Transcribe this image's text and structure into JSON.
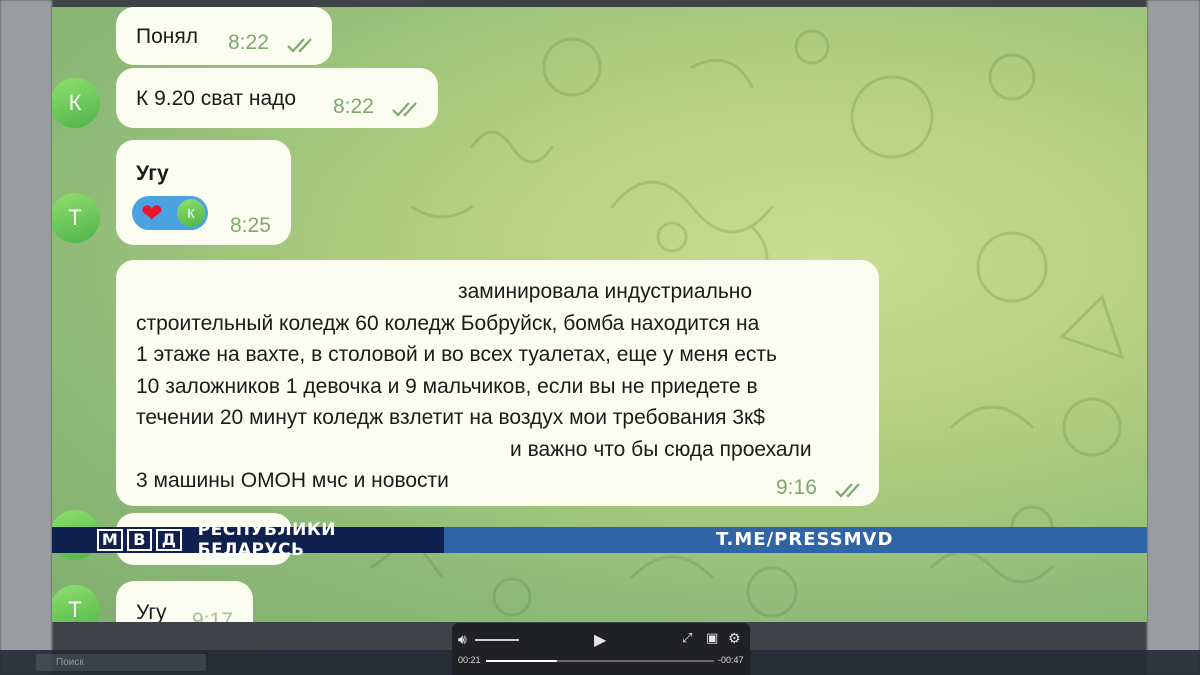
{
  "search_placeholder": "Поиск",
  "messages": [
    {
      "sender": "",
      "text": "Понял",
      "time": "8:22",
      "status": "read"
    },
    {
      "sender": "К",
      "text": "К 9.20 сват надо",
      "time": "8:22",
      "status": "read"
    },
    {
      "sender": "Т",
      "text": "Угу",
      "time": "8:25",
      "reaction": {
        "emoji": "❤",
        "reactor": "К"
      }
    },
    {
      "sender": "",
      "text_lines": [
        "заминировала индустриально",
        "строительный коледж 60 коледж Бобруйск, бомба находится на",
        "1 этаже на вахте, в столовой и во всех туалетах, еще у меня есть",
        "10 заложников 1 девочка и 9 мальчиков, если вы не приедете в",
        "течении 20 минут коледж взлетит на воздух мои требования 3к$",
        "и важно что бы сюда проехали",
        "3 машины ОМОН мчс и новости"
      ],
      "time": "9:16",
      "status": "read"
    },
    {
      "sender": "Т",
      "text": "Угу",
      "time": "9:17"
    }
  ],
  "banner": {
    "logo_letters": [
      "М",
      "В",
      "Д"
    ],
    "title": "РЕСПУБЛИКИ БЕЛАРУСЬ",
    "link": "T.ME/PRESSMVD"
  },
  "player": {
    "elapsed": "00:21",
    "remaining": "-00:47",
    "progress_fraction": 0.31
  },
  "colors": {
    "bubble": "#fbfdf1",
    "avatar_green": "#56b84c",
    "banner_dark": "#10214f",
    "banner_blue": "#2f64a6",
    "read_ticks": "#7ea870"
  }
}
